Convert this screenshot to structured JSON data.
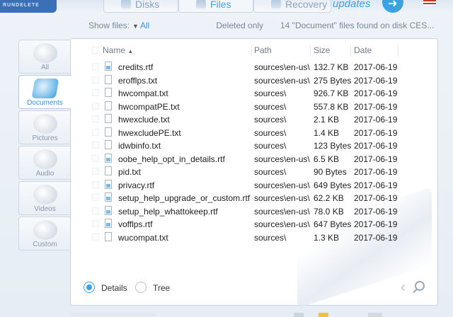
{
  "app": {
    "brand": "RUNDELETE"
  },
  "top_tabs": [
    {
      "label": "Disks",
      "icon": "disk-icon"
    },
    {
      "label": "Files",
      "icon": "files-icon"
    },
    {
      "label": "Recovery",
      "icon": "recovery-icon"
    }
  ],
  "updates": {
    "label": "updates"
  },
  "filters": {
    "show_files_label": "Show files:",
    "show_files_value": "All",
    "deleted_only_label": "Deleted only",
    "found_text": "14 \"Document\" files found on disk CES..."
  },
  "categories": [
    {
      "label": "All",
      "icon": "all-files-icon"
    },
    {
      "label": "Documents",
      "icon": "documents-icon"
    },
    {
      "label": "Pictures",
      "icon": "pictures-icon"
    },
    {
      "label": "Audio",
      "icon": "audio-icon"
    },
    {
      "label": "Videos",
      "icon": "videos-icon"
    },
    {
      "label": "Custom",
      "icon": "custom-icon"
    }
  ],
  "table": {
    "columns": {
      "name": "Name",
      "path": "Path",
      "size": "Size",
      "date": "Date"
    },
    "rows": [
      {
        "name": "credits.rtf",
        "type": "rtf",
        "path": "sources\\en-us\\",
        "size": "132.7 KB",
        "date": "2017-06-19"
      },
      {
        "name": "erofflps.txt",
        "type": "txt",
        "path": "sources\\en-us\\",
        "size": "275 Bytes",
        "date": "2017-06-19"
      },
      {
        "name": "hwcompat.txt",
        "type": "txt",
        "path": "sources\\",
        "size": "926.7 KB",
        "date": "2017-06-19"
      },
      {
        "name": "hwcompatPE.txt",
        "type": "txt",
        "path": "sources\\",
        "size": "557.8 KB",
        "date": "2017-06-19"
      },
      {
        "name": "hwexclude.txt",
        "type": "txt",
        "path": "sources\\",
        "size": "2.1 KB",
        "date": "2017-06-19"
      },
      {
        "name": "hwexcludePE.txt",
        "type": "txt",
        "path": "sources\\",
        "size": "1.4 KB",
        "date": "2017-06-19"
      },
      {
        "name": "idwbinfo.txt",
        "type": "txt",
        "path": "sources\\",
        "size": "123 Bytes",
        "date": "2017-06-19"
      },
      {
        "name": "oobe_help_opt_in_details.rtf",
        "type": "rtf",
        "path": "sources\\en-us\\",
        "size": "6.5 KB",
        "date": "2017-06-19"
      },
      {
        "name": "pid.txt",
        "type": "txt",
        "path": "sources\\",
        "size": "90 Bytes",
        "date": "2017-06-19"
      },
      {
        "name": "privacy.rtf",
        "type": "rtf",
        "path": "sources\\en-us\\",
        "size": "649 Bytes",
        "date": "2017-06-19"
      },
      {
        "name": "setup_help_upgrade_or_custom.rtf",
        "type": "rtf",
        "path": "sources\\en-us\\",
        "size": "62.2 KB",
        "date": "2017-06-19"
      },
      {
        "name": "setup_help_whattokeep.rtf",
        "type": "rtf",
        "path": "sources\\en-us\\",
        "size": "78.0 KB",
        "date": "2017-06-19"
      },
      {
        "name": "vofflps.rtf",
        "type": "rtf",
        "path": "sources\\en-us\\",
        "size": "647 Bytes",
        "date": "2017-06-19"
      },
      {
        "name": "wucompat.txt",
        "type": "txt",
        "path": "sources\\",
        "size": "1.3 KB",
        "date": "2017-06-19"
      }
    ]
  },
  "view": {
    "details_label": "Details",
    "tree_label": "Tree",
    "selected": "Details"
  }
}
